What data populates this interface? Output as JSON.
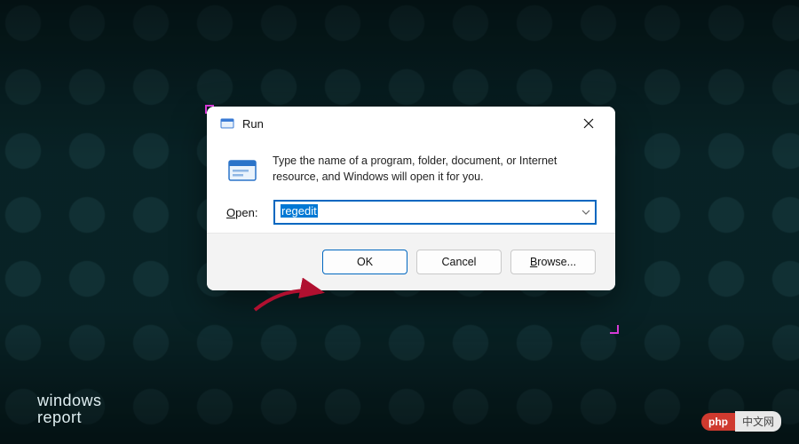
{
  "dialog": {
    "title": "Run",
    "instruction": "Type the name of a program, folder, document, or Internet resource, and Windows will open it for you.",
    "open_label_prefix": "O",
    "open_label_rest": "pen:",
    "input_value": "regedit",
    "buttons": {
      "ok": "OK",
      "cancel": "Cancel",
      "browse_prefix": "B",
      "browse_rest": "rowse..."
    }
  },
  "watermark_left_line1": "windows",
  "watermark_left_line2": "report",
  "watermark_right_pill": "php",
  "watermark_right_tail": "中文网"
}
